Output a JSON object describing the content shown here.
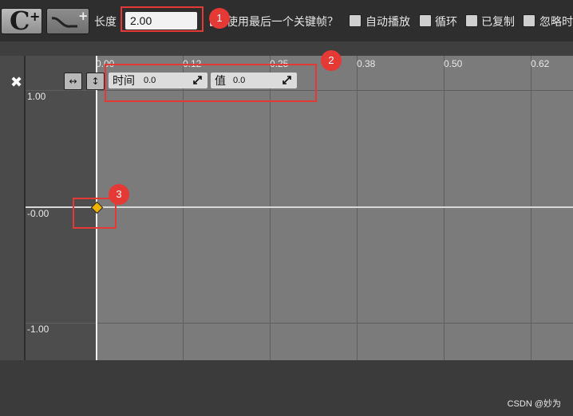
{
  "toolbar": {
    "length_label": "长度",
    "length_value": "2.00",
    "use_last_keyframe_label": "使用最后一个关键帧？",
    "autoplay_label": "自动播放",
    "loop_label": "循环",
    "replicated_label": "已复制",
    "ignore_time_dilation_label": "忽略时"
  },
  "editor": {
    "time_label": "时间",
    "time_value": "0.0",
    "value_label": "值",
    "value_value": "0.0",
    "x_ticks": [
      "0.00",
      "0.12",
      "0.25",
      "0.38",
      "0.50",
      "0.62"
    ],
    "y_ticks": [
      "1.00",
      "-0.00",
      "-1.00"
    ]
  },
  "annotations": [
    "1",
    "2",
    "3"
  ],
  "watermark": "CSDN @妙为",
  "colors": {
    "annotation": "#e53935",
    "keyframe": "#f0b400"
  },
  "icons": [
    "add-curve-c-icon",
    "add-curve-icon",
    "close-icon",
    "fit-horizontal-icon",
    "fit-vertical-icon",
    "expand-icon"
  ]
}
